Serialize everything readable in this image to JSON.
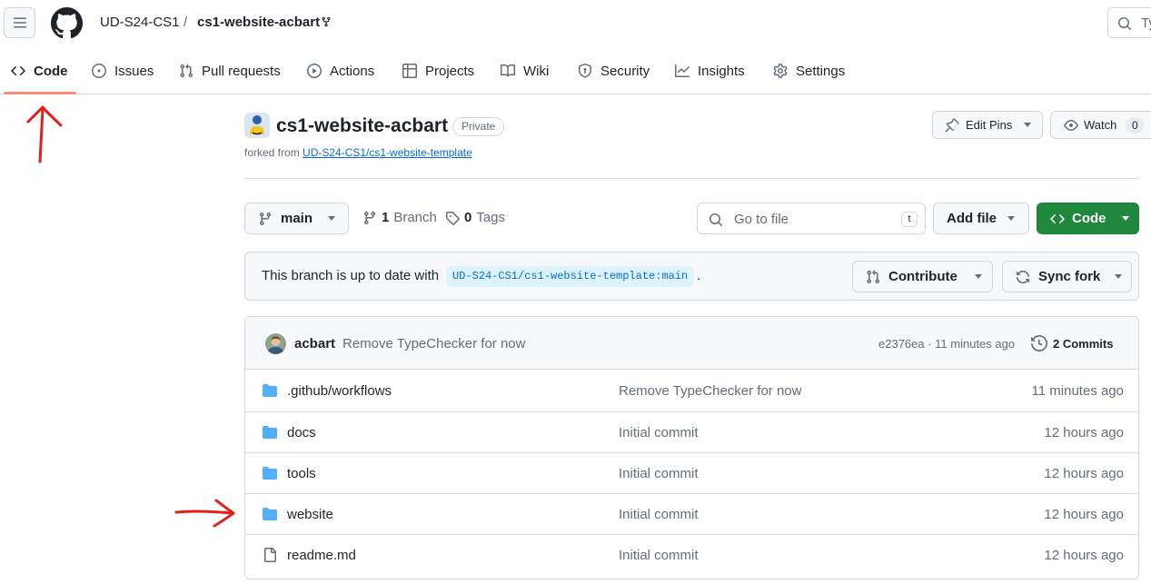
{
  "header": {
    "owner": "UD-S24-CS1",
    "separator": "/",
    "repo": "cs1-website-acbart",
    "search_placeholder": "Ty"
  },
  "nav": {
    "tabs": [
      {
        "label": "Code",
        "icon": "code-icon",
        "active": true
      },
      {
        "label": "Issues",
        "icon": "issue-icon"
      },
      {
        "label": "Pull requests",
        "icon": "pull-request-icon"
      },
      {
        "label": "Actions",
        "icon": "play-icon"
      },
      {
        "label": "Projects",
        "icon": "table-icon"
      },
      {
        "label": "Wiki",
        "icon": "book-icon"
      },
      {
        "label": "Security",
        "icon": "shield-icon"
      },
      {
        "label": "Insights",
        "icon": "graph-icon"
      },
      {
        "label": "Settings",
        "icon": "gear-icon"
      }
    ]
  },
  "repo": {
    "name": "cs1-website-acbart",
    "visibility": "Private",
    "forked_prefix": "forked from",
    "forked_source": "UD-S24-CS1/cs1-website-template",
    "edit_pins_label": "Edit Pins",
    "watch_label": "Watch",
    "watch_count": "0"
  },
  "file_nav": {
    "branch": "main",
    "branch_count": "1",
    "branch_label": "Branch",
    "tag_count": "0",
    "tag_label": "Tags",
    "goto_placeholder": "Go to file",
    "goto_shortcut": "t",
    "add_file_label": "Add file",
    "code_label": "Code"
  },
  "branch_status": {
    "text": "This branch is up to date with",
    "ref": "UD-S24-CS1/cs1-website-template:main",
    "suffix": ".",
    "contribute_label": "Contribute",
    "sync_fork_label": "Sync fork"
  },
  "latest_commit": {
    "author": "acbart",
    "message": "Remove TypeChecker for now",
    "meta": "e2376ea · 11 minutes ago",
    "commits_label": "2 Commits"
  },
  "files": [
    {
      "name": ".github/workflows",
      "type": "folder",
      "message": "Remove TypeChecker for now",
      "age": "11 minutes ago"
    },
    {
      "name": "docs",
      "type": "folder",
      "message": "Initial commit",
      "age": "12 hours ago"
    },
    {
      "name": "tools",
      "type": "folder",
      "message": "Initial commit",
      "age": "12 hours ago"
    },
    {
      "name": "website",
      "type": "folder",
      "message": "Initial commit",
      "age": "12 hours ago"
    },
    {
      "name": "readme.md",
      "type": "file",
      "message": "Initial commit",
      "age": "12 hours ago"
    }
  ],
  "colors": {
    "accent_green": "#1f883d",
    "link_blue": "#0969da",
    "folder_blue": "#54aeff",
    "active_tab_underline": "#fd8c73",
    "annotation_red": "#e0201a"
  }
}
